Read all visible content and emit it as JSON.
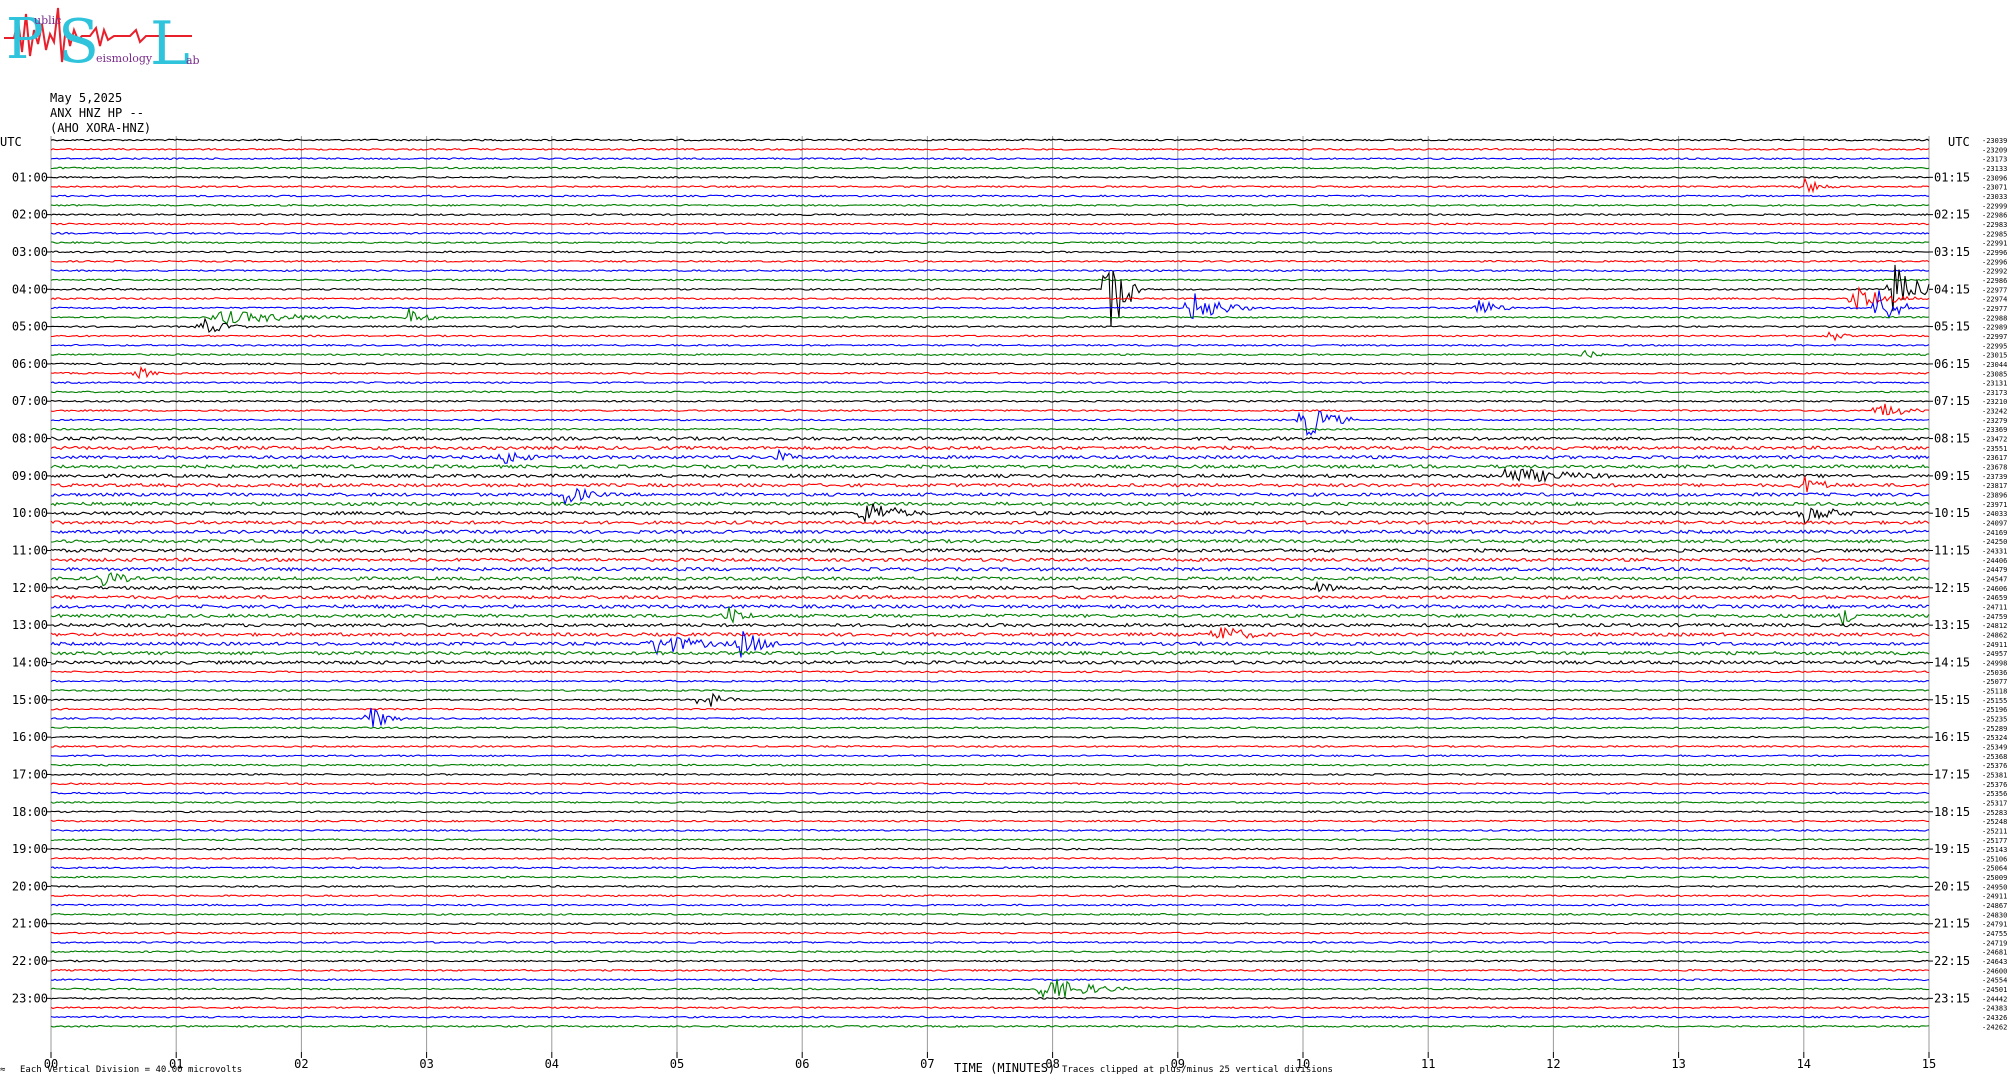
{
  "logo": {
    "letters": [
      "P",
      "S",
      "L"
    ],
    "word_public": "ublic",
    "word_seismology": "eismology",
    "word_lab": "ab",
    "color_letters": "#2fc4dc",
    "color_trace": "#e8202c"
  },
  "header": {
    "date": "May 5,2025",
    "station": "ANX HNZ HP --",
    "network": "(AHO XORA-HNZ)"
  },
  "utc_label_left": "UTC",
  "utc_label_right": "UTC",
  "footer": {
    "vertical_division": "Each Vertical Division =   40.00 microvolts",
    "x_axis_title": "TIME (MINUTES)",
    "clip_note": "Traces clipped at plus/minus 25 vertical divisions",
    "corner_mark": "≈"
  },
  "colors": {
    "black": "#000000",
    "red": "#ff0000",
    "blue": "#0000ff",
    "green": "#007f00",
    "grid": "#9a9a9a"
  },
  "chart_data": {
    "type": "line",
    "x_ticks": [
      "00",
      "01",
      "02",
      "03",
      "04",
      "05",
      "06",
      "07",
      "08",
      "09",
      "10",
      "11",
      "12",
      "13",
      "14",
      "15"
    ],
    "xlim": [
      0,
      15
    ],
    "xlabel": "TIME (MINUTES)",
    "trace_minutes": 15,
    "trace_count": 96,
    "color_cycle": [
      "black",
      "red",
      "blue",
      "green"
    ],
    "left_hour_labels": [
      "01:00",
      "02:00",
      "03:00",
      "04:00",
      "05:00",
      "06:00",
      "07:00",
      "08:00",
      "09:00",
      "10:00",
      "11:00",
      "12:00",
      "13:00",
      "14:00",
      "15:00",
      "16:00",
      "17:00",
      "18:00",
      "19:00",
      "20:00",
      "21:00",
      "22:00",
      "23:00"
    ],
    "right_hour_labels": [
      "01:15",
      "02:15",
      "03:15",
      "04:15",
      "05:15",
      "06:15",
      "07:15",
      "08:15",
      "09:15",
      "10:15",
      "11:15",
      "12:15",
      "13:15",
      "14:15",
      "15:15",
      "16:15",
      "17:15",
      "18:15",
      "19:15",
      "20:15",
      "21:15",
      "22:15",
      "23:15"
    ],
    "trace_offsets": [
      -23039,
      -23209,
      -23173,
      -23133,
      -23096,
      -23071,
      -23033,
      -22999,
      -22986,
      -22983,
      -22985,
      -22991,
      -22996,
      -22996,
      -22992,
      -22986,
      -22977,
      -22974,
      -22977,
      -22988,
      -22989,
      -22997,
      -22995,
      -23015,
      -23044,
      -23085,
      -23131,
      -23173,
      -23210,
      -23242,
      -23279,
      -23369,
      -23472,
      -23551,
      -23617,
      -23678,
      -23739,
      -23817,
      -23896,
      -23971,
      -24033,
      -24097,
      -24169,
      -24250,
      -24331,
      -24406,
      -24479,
      -24547,
      -24606,
      -24659,
      -24711,
      -24759,
      -24812,
      -24862,
      -24911,
      -24957,
      -24998,
      -25036,
      -25077,
      -25118,
      -25155,
      -25196,
      -25235,
      -25289,
      -25324,
      -25349,
      -25368,
      -25376,
      -25381,
      -25376,
      -25356,
      -25317,
      -25283,
      -25248,
      -25211,
      -25177,
      -25143,
      -25106,
      -25064,
      -25009,
      -24950,
      -24911,
      -24867,
      -24830,
      -24791,
      -24755,
      -24719,
      -24681,
      -24643,
      -24600,
      -24554,
      -24501,
      -24442,
      -24383,
      -24326,
      -24262
    ],
    "events": [
      {
        "trace": 5,
        "minute": 14.0,
        "amp": 9,
        "dur": 0.3
      },
      {
        "trace": 16,
        "minute": 8.45,
        "amp": 60,
        "dur": 0.25
      },
      {
        "trace": 16,
        "minute": 14.7,
        "amp": 30,
        "dur": 0.4
      },
      {
        "trace": 17,
        "minute": 14.4,
        "amp": 16,
        "dur": 0.5
      },
      {
        "trace": 18,
        "minute": 9.1,
        "amp": 18,
        "dur": 0.5
      },
      {
        "trace": 18,
        "minute": 11.4,
        "amp": 12,
        "dur": 0.3
      },
      {
        "trace": 18,
        "minute": 14.6,
        "amp": 22,
        "dur": 0.3
      },
      {
        "trace": 19,
        "minute": 1.3,
        "amp": 8,
        "dur": 1.4
      },
      {
        "trace": 19,
        "minute": 2.85,
        "amp": 10,
        "dur": 0.3
      },
      {
        "trace": 20,
        "minute": 1.2,
        "amp": 10,
        "dur": 0.4
      },
      {
        "trace": 21,
        "minute": 14.2,
        "amp": 8,
        "dur": 0.2
      },
      {
        "trace": 23,
        "minute": 12.25,
        "amp": 8,
        "dur": 0.2
      },
      {
        "trace": 25,
        "minute": 0.7,
        "amp": 8,
        "dur": 0.2
      },
      {
        "trace": 29,
        "minute": 14.6,
        "amp": 10,
        "dur": 0.4
      },
      {
        "trace": 30,
        "minute": 10.0,
        "amp": 22,
        "dur": 0.4
      },
      {
        "trace": 34,
        "minute": 3.6,
        "amp": 10,
        "dur": 0.4
      },
      {
        "trace": 34,
        "minute": 5.8,
        "amp": 8,
        "dur": 0.3
      },
      {
        "trace": 36,
        "minute": 11.6,
        "amp": 10,
        "dur": 1.2
      },
      {
        "trace": 37,
        "minute": 14.0,
        "amp": 10,
        "dur": 0.4
      },
      {
        "trace": 38,
        "minute": 4.1,
        "amp": 12,
        "dur": 0.4
      },
      {
        "trace": 40,
        "minute": 6.5,
        "amp": 16,
        "dur": 0.5
      },
      {
        "trace": 40,
        "minute": 14.0,
        "amp": 12,
        "dur": 0.5
      },
      {
        "trace": 47,
        "minute": 0.4,
        "amp": 10,
        "dur": 0.4
      },
      {
        "trace": 48,
        "minute": 10.1,
        "amp": 8,
        "dur": 0.3
      },
      {
        "trace": 51,
        "minute": 5.4,
        "amp": 12,
        "dur": 0.3
      },
      {
        "trace": 51,
        "minute": 14.3,
        "amp": 12,
        "dur": 0.3
      },
      {
        "trace": 54,
        "minute": 4.8,
        "amp": 14,
        "dur": 0.7
      },
      {
        "trace": 54,
        "minute": 5.5,
        "amp": 16,
        "dur": 0.4
      },
      {
        "trace": 53,
        "minute": 9.3,
        "amp": 12,
        "dur": 0.5
      },
      {
        "trace": 60,
        "minute": 5.2,
        "amp": 12,
        "dur": 0.3
      },
      {
        "trace": 62,
        "minute": 2.55,
        "amp": 14,
        "dur": 0.3
      },
      {
        "trace": 91,
        "minute": 7.9,
        "amp": 16,
        "dur": 0.7
      }
    ]
  }
}
